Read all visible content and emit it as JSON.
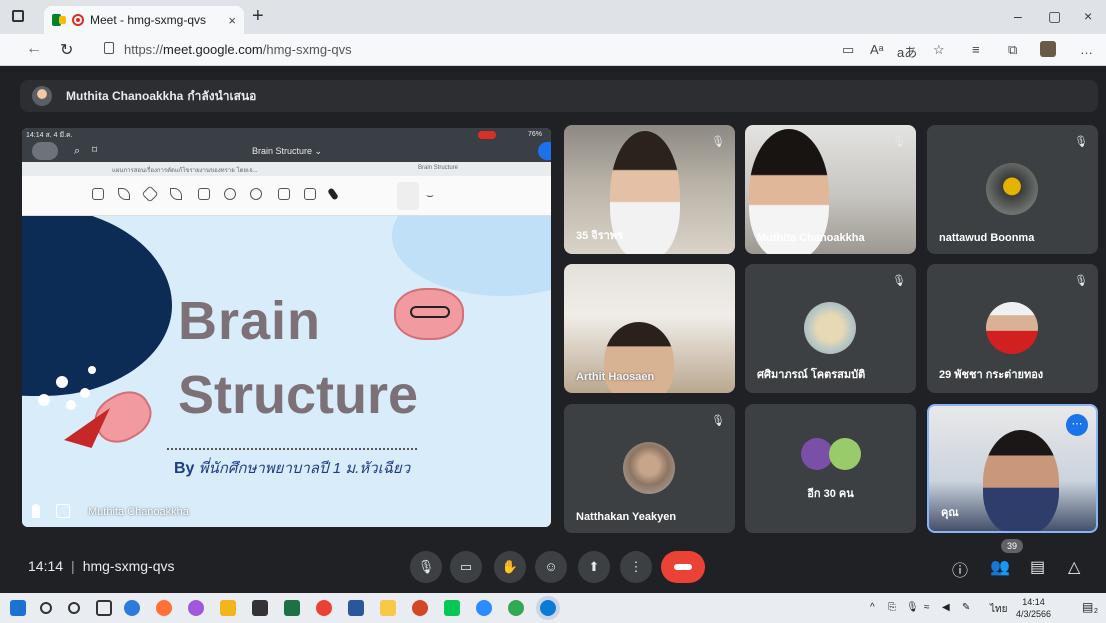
{
  "browser": {
    "tab_title": "Meet - hmg-sxmg-qvs",
    "tab_close": "×",
    "new_tab": "+",
    "url_prefix": "https://",
    "url_host": "meet.google.com",
    "url_path": "/hmg-sxmg-qvs",
    "window_controls": [
      "–",
      "▢",
      "×"
    ],
    "toolbar_right": [
      "Aᵃ",
      "aあ",
      "☆",
      "≡",
      "⧉",
      "…"
    ]
  },
  "banner": {
    "presenter_name": "Muthita Chanoakkha",
    "presenting_text": "กำลังนำเสนอ"
  },
  "presentation": {
    "ipad_time": "14:14  ส. 4 มี.ค.",
    "doc_title": "Brain Structure ⌄",
    "tab_label": "Brain Structure",
    "tab_left": "แผนการสอนเรื่องการตัดแก้ไขรายงานของทราย โดยเจ...",
    "slide_title_line1": "Brain",
    "slide_title_line2": "Structure",
    "slide_by_prefix": "By",
    "slide_by_text": "พี่นักศึกษาพยาบาลปี 1 ม.หัวเฉียว",
    "presenter_footer": "Muthita Chanoakkha",
    "battery": "76%"
  },
  "participants": [
    {
      "name": "35 จิราพร",
      "muted": true,
      "type": "video"
    },
    {
      "name": "Muthita Chanoakkha",
      "muted": true,
      "type": "video"
    },
    {
      "name": "nattawud Boonma",
      "muted": true,
      "type": "avatar"
    },
    {
      "name": "Arthit Haosaen",
      "muted": false,
      "type": "video"
    },
    {
      "name": "ศศิมาภรณ์ โคตรสมบัติ",
      "muted": true,
      "type": "avatar"
    },
    {
      "name": "29 พัชชา กระต่ายทอง",
      "muted": true,
      "type": "avatar"
    },
    {
      "name": "Natthakan Yeakyen",
      "muted": true,
      "type": "avatar"
    },
    {
      "name": "อีก 30 คน",
      "muted": false,
      "type": "group"
    },
    {
      "name": "คุณ",
      "muted": false,
      "type": "video"
    }
  ],
  "controls": {
    "time": "14:14",
    "meeting_code": "hmg-sxmg-qvs",
    "participant_count": "39"
  },
  "taskbar": {
    "clock_time": "14:14",
    "clock_date": "4/3/2566",
    "lang": "ไทย",
    "notif_count": "2"
  },
  "colors": {
    "meet_bg": "#202124",
    "end_call": "#ea4335",
    "accent": "#1a73e8",
    "slide_title": "#7b7177"
  }
}
